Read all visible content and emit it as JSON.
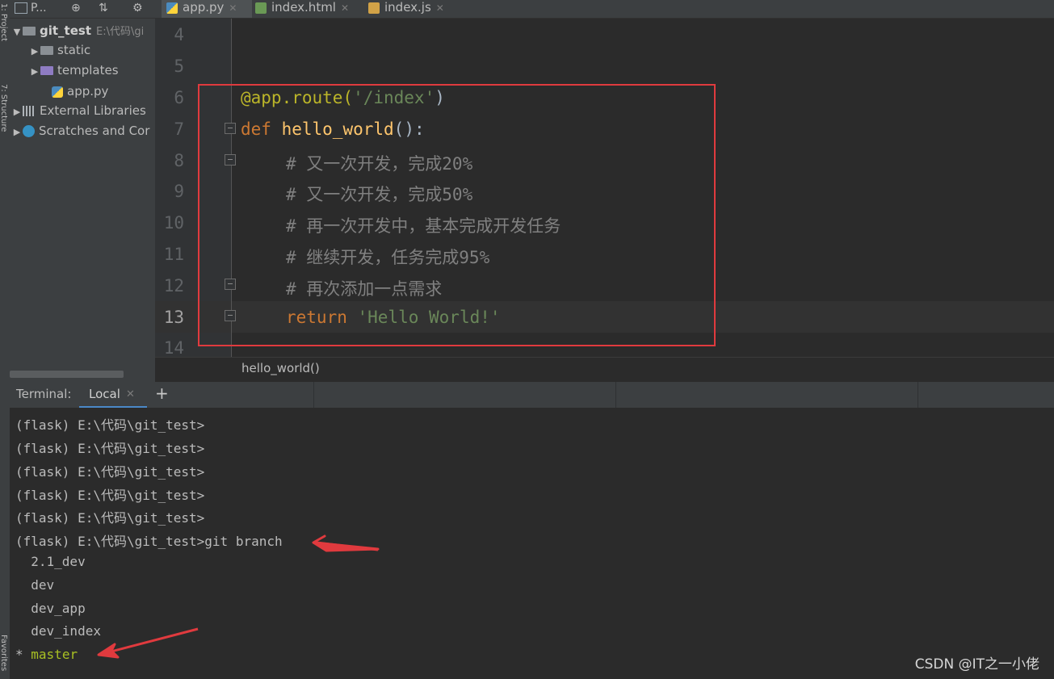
{
  "side_strip": {
    "project_label": "1: Project",
    "structure_label": "7: Structure",
    "favorites_label": "Favorites"
  },
  "project_panel": {
    "header": "P...",
    "tree": [
      {
        "label": "git_test",
        "hint": "E:\\代码\\gi",
        "kind": "folder",
        "expanded": true
      },
      {
        "label": "static",
        "kind": "folder",
        "expanded": false
      },
      {
        "label": "templates",
        "kind": "folder-purple",
        "expanded": false
      },
      {
        "label": "app.py",
        "kind": "python-file"
      },
      {
        "label": "External Libraries",
        "kind": "libraries",
        "expanded": false
      },
      {
        "label": "Scratches and Cor",
        "kind": "scratches",
        "expanded": false
      }
    ]
  },
  "tabs": [
    {
      "label": "app.py",
      "active": true,
      "icon": "python-file-icon"
    },
    {
      "label": "index.html",
      "active": false,
      "icon": "html-file-icon"
    },
    {
      "label": "index.js",
      "active": false,
      "icon": "js-file-icon"
    }
  ],
  "editor": {
    "line_numbers": [
      "4",
      "5",
      "6",
      "7",
      "8",
      "9",
      "10",
      "11",
      "12",
      "13",
      "14"
    ],
    "current_line": "13",
    "lines": {
      "l6_decorator": "@app.route(",
      "l6_arg": "'/index'",
      "l6_close": ")",
      "l7_def": "def",
      "l7_name": "hello_world",
      "l7_rest": "():",
      "l8": "# 又一次开发，完成20%",
      "l9": "# 又一次开发，完成50%",
      "l10": "# 再一次开发中，基本完成开发任务",
      "l11": "# 继续开发，任务完成95%",
      "l12": "# 再次添加一点需求",
      "l13_kw": "return",
      "l13_str": "'Hello World!'"
    },
    "breadcrumb": "hello_world()"
  },
  "terminal": {
    "title": "Terminal:",
    "tab_label": "Local",
    "add_label": "+",
    "lines": [
      "(flask) E:\\代码\\git_test>",
      "(flask) E:\\代码\\git_test>",
      "(flask) E:\\代码\\git_test>",
      "(flask) E:\\代码\\git_test>",
      "(flask) E:\\代码\\git_test>",
      "(flask) E:\\代码\\git_test>git branch",
      "  2.1_dev",
      "  dev",
      "  dev_app",
      "  dev_index"
    ],
    "current_branch_marker": "*",
    "current_branch": "master"
  },
  "watermark": "CSDN @IT之一小佬",
  "colors": {
    "annotation_red": "#e03a3e",
    "keyword": "#cc7832",
    "function": "#ffc66d",
    "string": "#6a8759",
    "decorator": "#bbb529",
    "comment": "#808080",
    "current_branch": "#a8c023"
  }
}
